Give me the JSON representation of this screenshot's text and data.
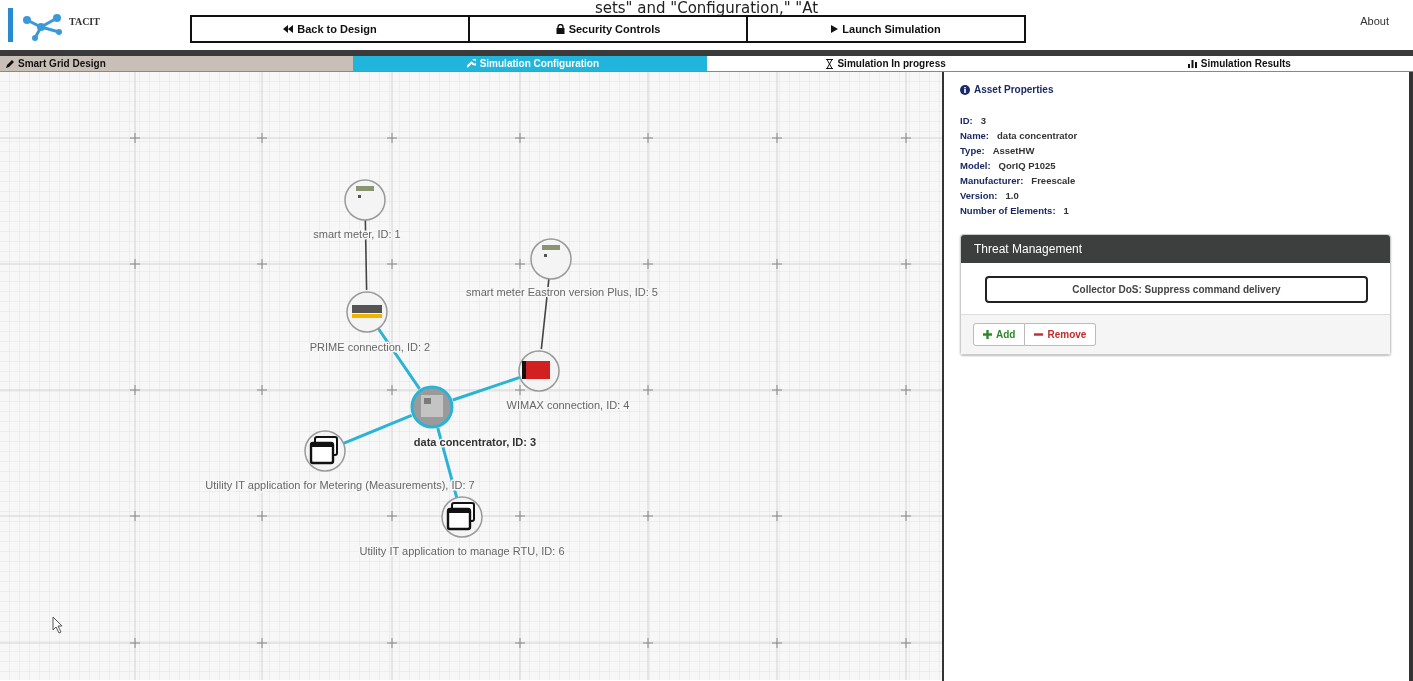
{
  "overlay_caption": "sets\" and \"Configuration,\" \"At",
  "logo": {
    "text": "TACIT"
  },
  "nav_buttons": [
    {
      "label": "Back to Design",
      "kind": "back"
    },
    {
      "label": "Security Controls",
      "kind": "lock"
    },
    {
      "label": "Launch Simulation",
      "kind": "play"
    }
  ],
  "about_link": "About",
  "tabs": [
    {
      "label": "Smart Grid Design",
      "kind": "pencil",
      "selected": false,
      "completed": true
    },
    {
      "label": "Simulation Configuration",
      "kind": "wrench",
      "selected": true,
      "completed": false
    },
    {
      "label": "Simulation In progress",
      "kind": "hourglass",
      "selected": false,
      "completed": false
    },
    {
      "label": "Simulation Results",
      "kind": "chart",
      "selected": false,
      "completed": false
    }
  ],
  "graph": {
    "nodes": [
      {
        "label": "smart meter, ID: 1",
        "kind": "meter",
        "selected": false
      },
      {
        "label": "smart meter Eastron version Plus, ID: 5",
        "kind": "meter",
        "selected": false
      },
      {
        "label": "PRIME connection, ID: 2",
        "kind": "prime",
        "selected": false
      },
      {
        "label": "WIMAX connection, ID: 4",
        "kind": "wimax",
        "selected": false
      },
      {
        "label": "data concentrator, ID: 3",
        "kind": "concentrator",
        "selected": true
      },
      {
        "label": "Utility IT application for Metering (Measurements), ID: 7",
        "kind": "app",
        "selected": false
      },
      {
        "label": "Utility IT application to manage RTU, ID: 6",
        "kind": "app",
        "selected": false
      }
    ],
    "edges": [
      {
        "highlighted": false
      },
      {
        "highlighted": false
      },
      {
        "highlighted": true
      },
      {
        "highlighted": true
      },
      {
        "highlighted": true
      },
      {
        "highlighted": true
      }
    ]
  },
  "asset_properties": {
    "title": "Asset Properties",
    "fields": [
      {
        "label": "ID:",
        "value": "3"
      },
      {
        "label": "Name:",
        "value": "data concentrator"
      },
      {
        "label": "Type:",
        "value": "AssetHW"
      },
      {
        "label": "Model:",
        "value": "QorIQ P1025"
      },
      {
        "label": "Manufacturer:",
        "value": "Freescale"
      },
      {
        "label": "Version:",
        "value": "1.0"
      },
      {
        "label": "Number of Elements:",
        "value": "1"
      }
    ]
  },
  "threat_management": {
    "title": "Threat Management",
    "threats": [
      "Collector DoS: Suppress command delivery"
    ],
    "buttons": [
      {
        "label": "Add",
        "kind": "add"
      },
      {
        "label": "Remove",
        "kind": "remove"
      }
    ]
  }
}
